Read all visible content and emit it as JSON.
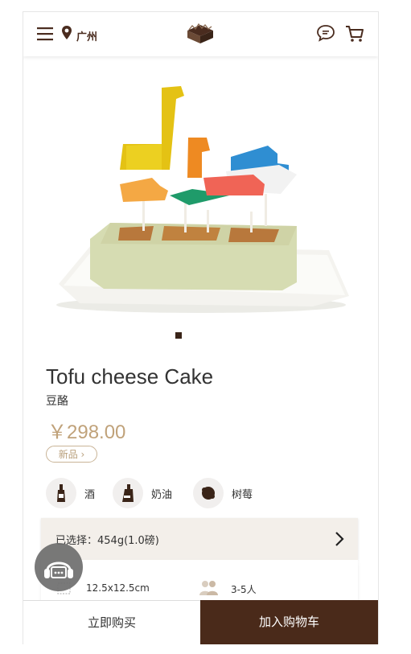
{
  "header": {
    "menu_icon": "hamburger-icon",
    "location_icon": "map-pin-icon",
    "city": "广州",
    "logo_icon": "cake-logo-icon",
    "chat_icon": "chat-bubble-icon",
    "cart_icon": "shopping-cart-icon"
  },
  "carousel": {
    "image": "tofu-cheese-cake-photo",
    "current": 1,
    "total": 1
  },
  "product": {
    "name": "Tofu cheese Cake",
    "name_cn": "豆酪",
    "price": "￥298.00",
    "tag": "新品 ›"
  },
  "flavors": [
    {
      "icon": "wine-bottle-icon",
      "label": "酒"
    },
    {
      "icon": "cream-icon",
      "label": "奶油"
    },
    {
      "icon": "berry-icon",
      "label": "树莓"
    }
  ],
  "selection": {
    "label": "已选择：454g(1.0磅)",
    "arrow": "chevron-right-icon"
  },
  "specs": [
    {
      "icon": "size-icon",
      "text": "12.5x12.5cm"
    },
    {
      "icon": "people-icon",
      "text": "3-5人"
    }
  ],
  "actions": {
    "buy_now": "立即购买",
    "add_to_cart": "加入购物车"
  },
  "service_icon": "customer-service-icon",
  "colors": {
    "brand_dark": "#4a2a1a",
    "price": "#c0a27a",
    "panel": "#f3efea"
  }
}
